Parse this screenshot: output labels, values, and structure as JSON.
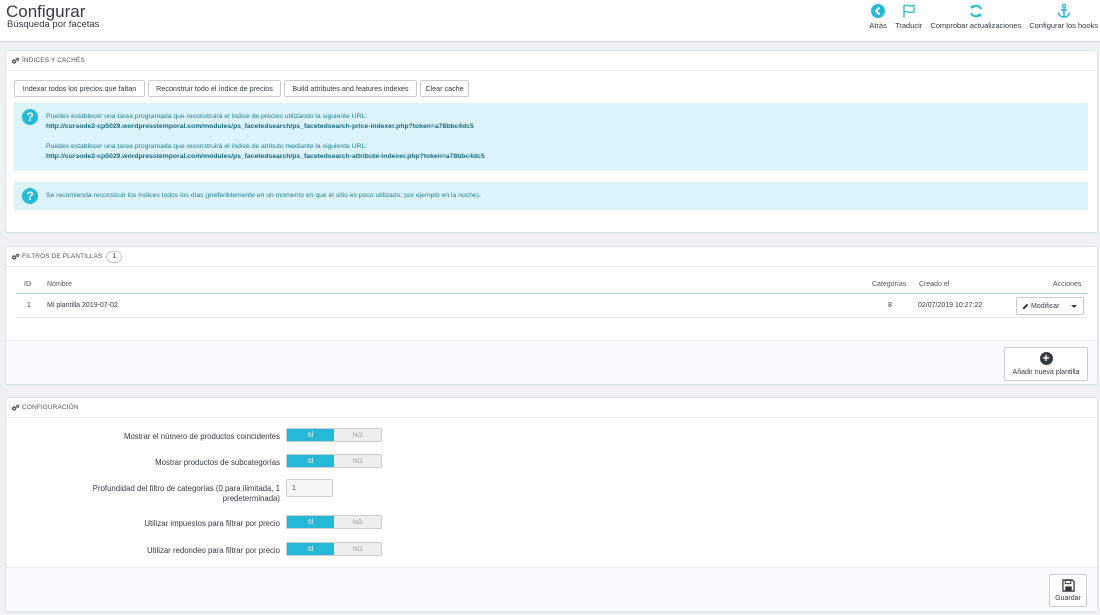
{
  "header": {
    "title": "Configurar",
    "subtitle": "Búsqueda por facetas",
    "toolbar": [
      {
        "label": "Atrás",
        "icon": "back-arrow-icon"
      },
      {
        "label": "Traducir",
        "icon": "flag-icon"
      },
      {
        "label": "Comprobar actualizaciones",
        "icon": "refresh-icon"
      },
      {
        "label": "Configurar los hooks",
        "icon": "anchor-icon"
      }
    ]
  },
  "indexes": {
    "heading": "Índices y cachés",
    "buttons": [
      "Indexar todos los precios que faltan",
      "Reconstruir todo el índice de precios",
      "Build attributes and features indexes",
      "Clear cache"
    ],
    "info1": {
      "text1": "Puedes establecer una tarea programada que reconstruirá el índice de precios utilizando la siguiente URL:",
      "url1": "http://cursode2-cp5029.wordpresstemporal.com/modules/ps_facetedsearch/ps_facetedsearch-price-indexer.php?token=a78bbc4dc5",
      "text2": "Puedes establecer una tarea programada que reconstruirá el índice de atributo mediante la siguiente URL:",
      "url2": "http://cursode2-cp5029.wordpresstemporal.com/modules/ps_facetedsearch/ps_facetedsearch-attribute-indexer.php?token=a78bbc4dc5"
    },
    "info2": "Se recomienda reconstruir los índices todos los días (preferiblemente en un momento en que el sitio es poco utilizado, por ejemplo en la noche)."
  },
  "templates": {
    "heading": "Filtros de plantillas",
    "count": "1",
    "columns": {
      "id": "ID",
      "name": "Nombre",
      "categories": "Categorías",
      "created": "Creado el",
      "actions": "Acciones"
    },
    "rows": [
      {
        "id": "1",
        "name": "Mi plantilla 2019-07-02",
        "categories": "8",
        "created": "02/07/2019 10:27:22"
      }
    ],
    "modify_label": "Modificar",
    "add_label": "Añadir nueva plantilla"
  },
  "config": {
    "heading": "Configuración",
    "on_label": "SÍ",
    "off_label": "NO",
    "fields": [
      "Mostrar el número de productos coincidentes",
      "Mostrar productos de subcategorías",
      "Profundidad del filtro de categorías (0 para ilimitada, 1 predeterminada)",
      "Utilizar impuestos para filtrar por precio",
      "Utilizar redondeo para filtrar por precio"
    ],
    "depth_value": "1",
    "save_label": "Guardar"
  },
  "colors": {
    "accent": "#25b9d7",
    "info_bg": "#dcf4f9",
    "info_text": "#1e8198"
  }
}
